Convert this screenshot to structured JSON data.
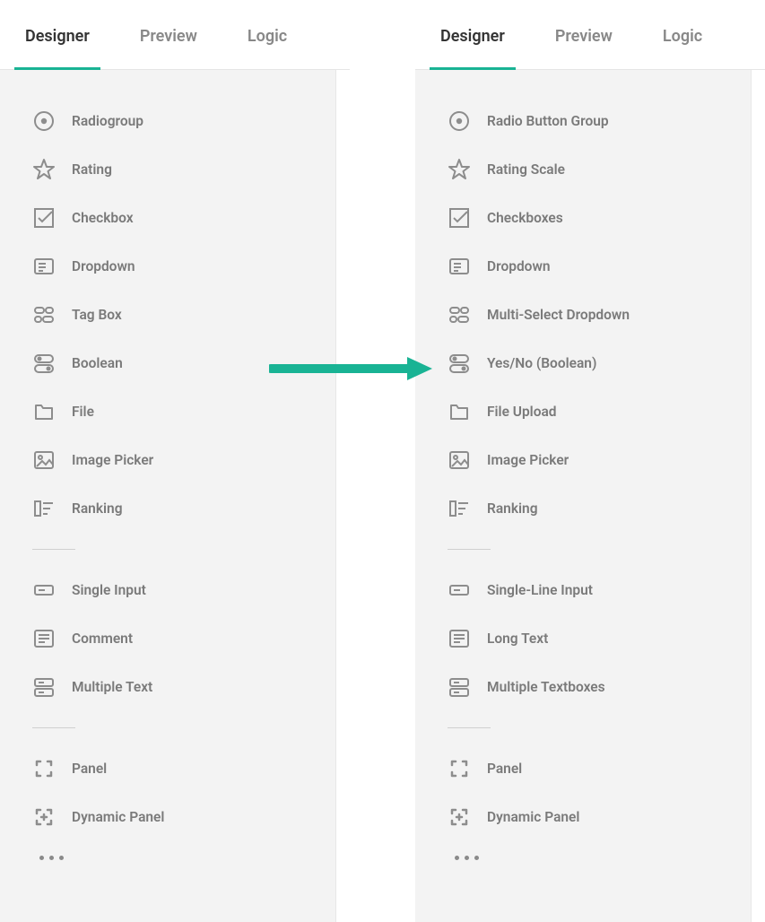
{
  "tabs": [
    "Designer",
    "Preview",
    "Logic"
  ],
  "left": {
    "group1": [
      {
        "icon": "radio",
        "label": "Radiogroup"
      },
      {
        "icon": "rating",
        "label": "Rating"
      },
      {
        "icon": "checkbox",
        "label": "Checkbox"
      },
      {
        "icon": "dropdown",
        "label": "Dropdown"
      },
      {
        "icon": "tagbox",
        "label": "Tag Box"
      },
      {
        "icon": "boolean",
        "label": "Boolean"
      },
      {
        "icon": "file",
        "label": "File"
      },
      {
        "icon": "imagepicker",
        "label": "Image Picker"
      },
      {
        "icon": "ranking",
        "label": "Ranking"
      }
    ],
    "group2": [
      {
        "icon": "singleinput",
        "label": "Single Input"
      },
      {
        "icon": "comment",
        "label": "Comment"
      },
      {
        "icon": "multipletext",
        "label": "Multiple Text"
      }
    ],
    "group3": [
      {
        "icon": "panel",
        "label": "Panel"
      },
      {
        "icon": "dynamicpanel",
        "label": "Dynamic Panel"
      }
    ]
  },
  "right": {
    "group1": [
      {
        "icon": "radio",
        "label": "Radio Button Group"
      },
      {
        "icon": "rating",
        "label": "Rating Scale"
      },
      {
        "icon": "checkbox",
        "label": "Checkboxes"
      },
      {
        "icon": "dropdown",
        "label": "Dropdown"
      },
      {
        "icon": "tagbox",
        "label": "Multi-Select Dropdown"
      },
      {
        "icon": "boolean",
        "label": "Yes/No (Boolean)"
      },
      {
        "icon": "file",
        "label": "File Upload"
      },
      {
        "icon": "imagepicker",
        "label": "Image Picker"
      },
      {
        "icon": "ranking",
        "label": "Ranking"
      }
    ],
    "group2": [
      {
        "icon": "singleinput",
        "label": "Single-Line Input"
      },
      {
        "icon": "comment",
        "label": "Long Text"
      },
      {
        "icon": "multipletext",
        "label": "Multiple Textboxes"
      }
    ],
    "group3": [
      {
        "icon": "panel",
        "label": "Panel"
      },
      {
        "icon": "dynamicpanel",
        "label": "Dynamic Panel"
      }
    ]
  }
}
